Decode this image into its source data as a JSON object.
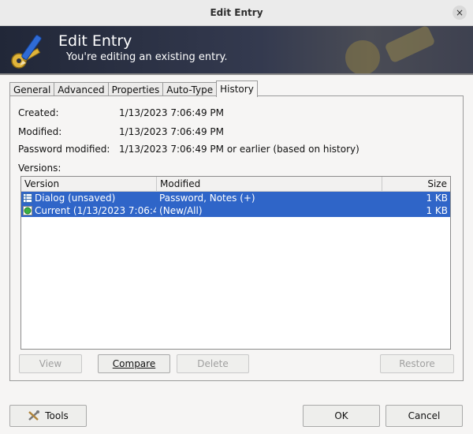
{
  "window": {
    "title": "Edit Entry",
    "close_glyph": "×"
  },
  "banner": {
    "title": "Edit Entry",
    "subtitle": "You're editing an existing entry."
  },
  "tabs": [
    {
      "label": "General",
      "active": false
    },
    {
      "label": "Advanced",
      "active": false
    },
    {
      "label": "Properties",
      "active": false
    },
    {
      "label": "Auto-Type",
      "active": false
    },
    {
      "label": "History",
      "active": true
    }
  ],
  "history": {
    "created_label": "Created:",
    "created_value": "1/13/2023 7:06:49 PM",
    "modified_label": "Modified:",
    "modified_value": "1/13/2023 7:06:49 PM",
    "pw_modified_label": "Password modified:",
    "pw_modified_value": "1/13/2023 7:06:49 PM or earlier (based on history)",
    "versions_label": "Versions:",
    "columns": {
      "version": "Version",
      "modified": "Modified",
      "size": "Size"
    },
    "rows": [
      {
        "version": "Dialog (unsaved)",
        "modified": "Password, Notes (+)",
        "size": "1 KB",
        "icon": "table-icon"
      },
      {
        "version": "Current (1/13/2023 7:06:4…",
        "modified": "(New/All)",
        "size": "1 KB",
        "icon": "green-circle-icon"
      }
    ],
    "buttons": {
      "view": "View",
      "compare": "Compare",
      "delete": "Delete",
      "restore": "Restore"
    }
  },
  "footer": {
    "tools": "Tools",
    "ok": "OK",
    "cancel": "Cancel"
  },
  "colors": {
    "selection": "#2f65c8",
    "banner": "#2a3042"
  }
}
